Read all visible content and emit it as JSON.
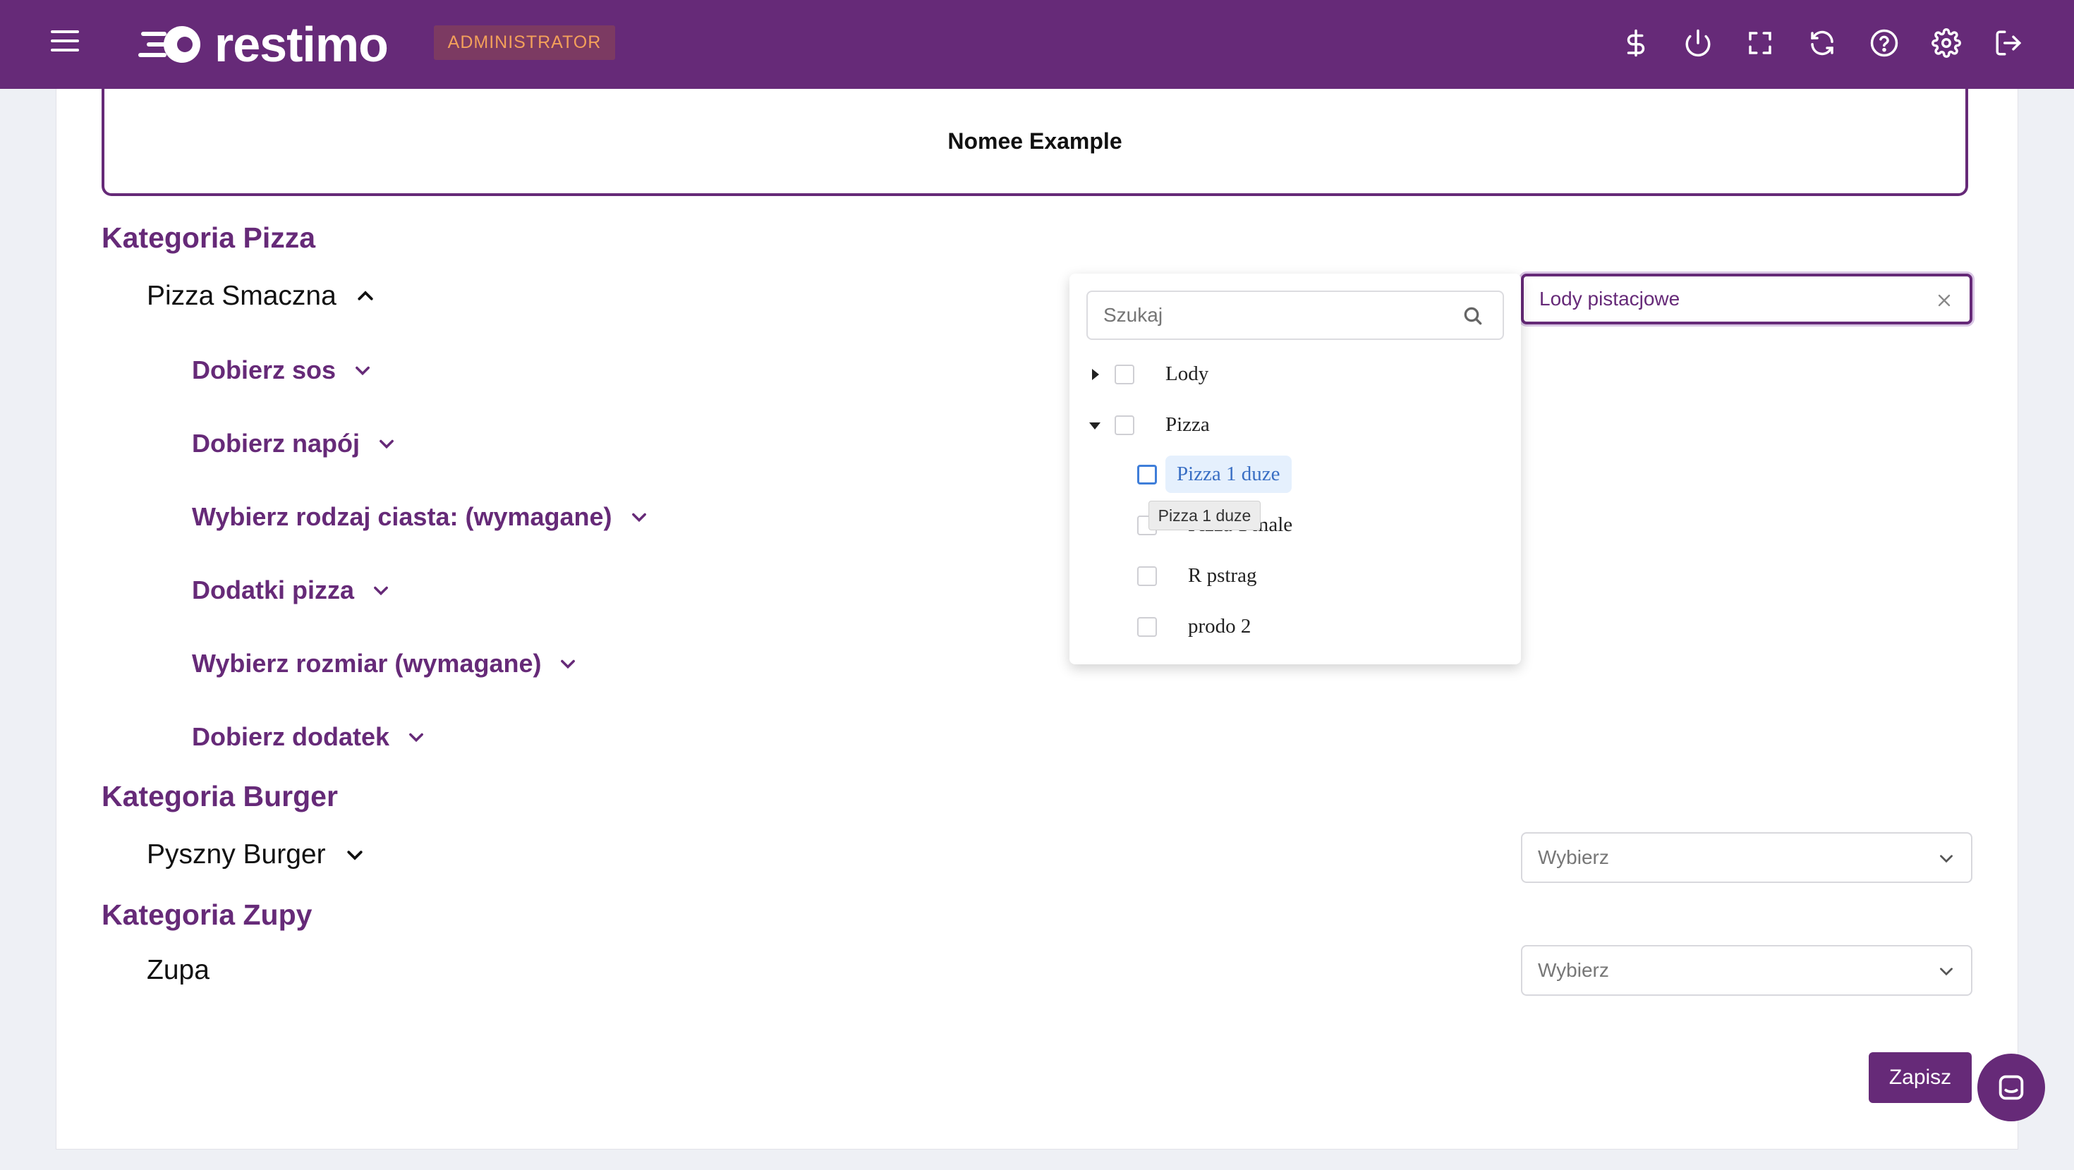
{
  "colors": {
    "brand": "#662a78",
    "badge_text": "#f3a05a",
    "highlight": "#e5f0fd"
  },
  "header": {
    "logo_text": "restimo",
    "role_badge": "ADMINISTRATOR",
    "icons": [
      "menu-icon",
      "dollar-icon",
      "power-icon",
      "fullscreen-icon",
      "refresh-icon",
      "help-icon",
      "settings-icon",
      "logout-icon"
    ]
  },
  "main": {
    "name_box": "Nomee Example",
    "categories": [
      {
        "title": "Kategoria Pizza",
        "product": "Pizza Smaczna",
        "groups": [
          "Dobierz sos",
          "Dobierz napój",
          "Wybierz rodzaj ciasta: (wymagane)",
          "Dodatki pizza",
          "Wybierz rozmiar (wymagane)",
          "Dobierz dodatek"
        ],
        "select_value": "Lody pistacjowe"
      },
      {
        "title": "Kategoria Burger",
        "product": "Pyszny Burger",
        "select_placeholder": "Wybierz"
      },
      {
        "title": "Kategoria Zupy",
        "product": "Zupa",
        "select_placeholder": "Wybierz"
      }
    ]
  },
  "dropdown": {
    "search_placeholder": "Szukaj",
    "tree": [
      {
        "label": "Lody",
        "expanded": false
      },
      {
        "label": "Pizza",
        "expanded": true,
        "children": [
          "Pizza 1 duze",
          "Pizza 1 male",
          "R pstrag",
          "prodo 2"
        ]
      }
    ],
    "hovered_item": "Pizza 1 duze",
    "tooltip": "Pizza 1 duze"
  },
  "footer": {
    "save_label": "Zapisz"
  }
}
